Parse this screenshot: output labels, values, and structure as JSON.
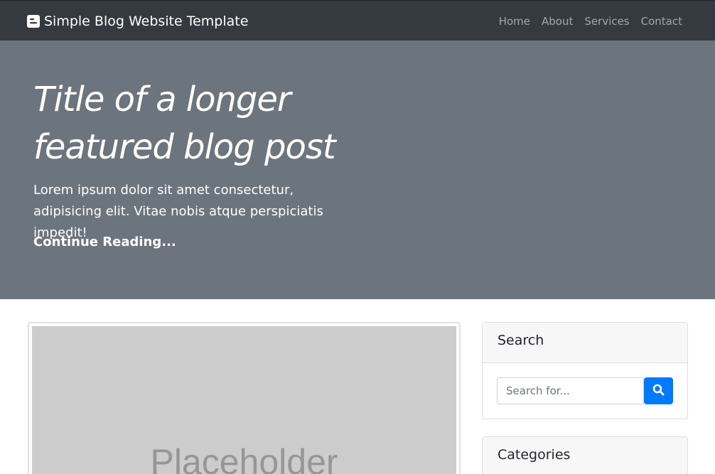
{
  "navbar": {
    "brand": "Simple Blog Website Template",
    "brand_icon": "blogger-icon",
    "links": [
      "Home",
      "About",
      "Services",
      "Contact"
    ]
  },
  "hero": {
    "title": "Title of a longer featured blog post",
    "lead": "Lorem ipsum dolor sit amet consectetur, adipisicing elit. Vitae nobis atque perspiciatis impedit!",
    "link": "Continue Reading..."
  },
  "post": {
    "image_text": "Placeholder"
  },
  "sidebar": {
    "search": {
      "title": "Search",
      "placeholder": "Search for...",
      "button_icon": "search-icon"
    },
    "categories": {
      "title": "Categories"
    }
  },
  "colors": {
    "navbar_bg": "#343a40",
    "hero_bg": "#6c757d",
    "primary": "#007bff",
    "placeholder_bg": "#cccccc"
  }
}
